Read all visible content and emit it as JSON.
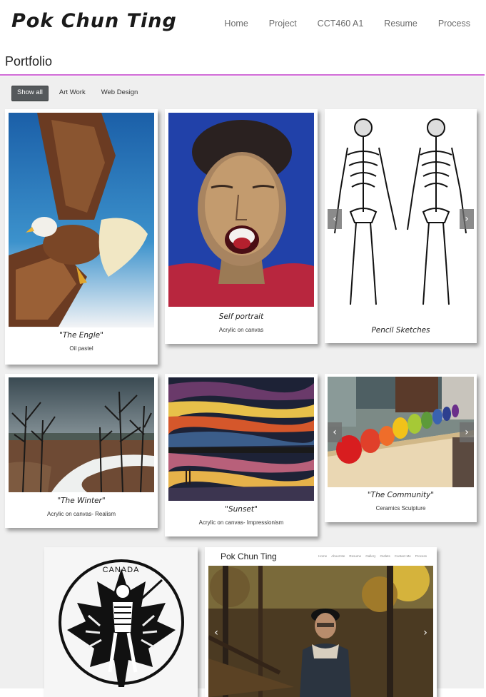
{
  "header": {
    "logo": "Pok Chun Ting",
    "nav": [
      "Home",
      "Project",
      "CCT460 A1",
      "Resume",
      "Process"
    ]
  },
  "page": {
    "title": "Portfolio"
  },
  "filters": [
    "Show all",
    "Art Work",
    "Web Design"
  ],
  "cards": {
    "engle": {
      "title": "\"The Engle\"",
      "subtitle": "Oil pastel"
    },
    "self": {
      "title": "Self portrait",
      "subtitle": "Acrylic on canvas"
    },
    "pencil": {
      "title": "Pencil Sketches"
    },
    "winter": {
      "title": "\"The Winter\"",
      "subtitle": "Acrylic on canvas- Realism"
    },
    "sunset": {
      "title": "\"Sunset\"",
      "subtitle": "Acrylic on canvas- Impressionism"
    },
    "community": {
      "title": "\"The Community\"",
      "subtitle": "Ceramics Sculpture"
    },
    "canada": {
      "label": "CANADA"
    },
    "website": {
      "title": "Pok Chun Ting",
      "nav": [
        "Home",
        "About Me",
        "Resume",
        "Gallery",
        "Outlets",
        "Contact Me",
        "Process"
      ]
    }
  },
  "arrows": {
    "prev": "‹",
    "next": "›"
  },
  "colors": {
    "accent_rule": "#d06ad6",
    "active_filter": "#55595c",
    "page_bg": "#efefef"
  }
}
